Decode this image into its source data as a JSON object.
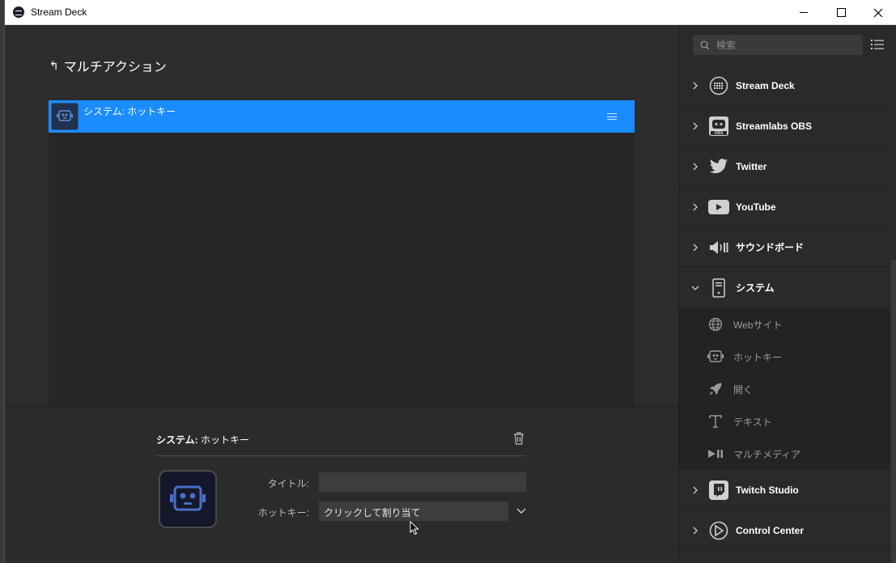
{
  "window": {
    "title": "Stream Deck"
  },
  "main": {
    "back_title": "マルチアクション",
    "actions": [
      {
        "label": "システム: ホットキー"
      }
    ]
  },
  "inspector": {
    "title_prefix": "システム: ",
    "title_action": "ホットキー",
    "title_label": "タイトル:",
    "title_value": "",
    "hotkey_label": "ホットキー:",
    "hotkey_value": "クリックして割り当て"
  },
  "sidebar": {
    "search_placeholder": "検索",
    "categories": [
      {
        "label": "Stream Deck",
        "icon": "stream-deck-icon",
        "expanded": false
      },
      {
        "label": "Streamlabs OBS",
        "icon": "streamlabs-obs-icon",
        "expanded": false
      },
      {
        "label": "Twitter",
        "icon": "twitter-icon",
        "expanded": false
      },
      {
        "label": "YouTube",
        "icon": "youtube-icon",
        "expanded": false
      },
      {
        "label": "サウンドボード",
        "icon": "soundboard-icon",
        "expanded": false
      },
      {
        "label": "システム",
        "icon": "system-icon",
        "expanded": true
      },
      {
        "label": "Twitch Studio",
        "icon": "twitch-studio-icon",
        "expanded": false
      },
      {
        "label": "Control Center",
        "icon": "control-center-icon",
        "expanded": false
      }
    ],
    "system_actions": [
      {
        "label": "Webサイト",
        "icon": "globe-icon"
      },
      {
        "label": "ホットキー",
        "icon": "robot-icon"
      },
      {
        "label": "開く",
        "icon": "rocket-icon"
      },
      {
        "label": "テキスト",
        "icon": "text-icon"
      },
      {
        "label": "マルチメディア",
        "icon": "play-pause-icon"
      }
    ]
  },
  "colors": {
    "accent": "#1a8cff",
    "background": "#2d2d2d",
    "sidebar": "#2a2a2a"
  }
}
